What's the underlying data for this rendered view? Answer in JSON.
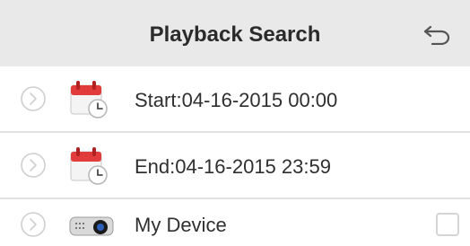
{
  "header": {
    "title": "Playback Search",
    "back_icon": "back-arrow-icon"
  },
  "rows": [
    {
      "label": "Start:04-16-2015 00:00",
      "icon": "calendar-clock-icon",
      "expand_icon": "chevron-right-circle-icon"
    },
    {
      "label": "End:04-16-2015 23:59",
      "icon": "calendar-clock-icon",
      "expand_icon": "chevron-right-circle-icon"
    },
    {
      "label": "My Device",
      "icon": "camera-device-icon",
      "expand_icon": "chevron-right-circle-icon",
      "checked": false
    }
  ],
  "colors": {
    "header_bg": "#e9e9e9",
    "calendar_red": "#e23b3b",
    "separator": "#e2e2e2"
  }
}
